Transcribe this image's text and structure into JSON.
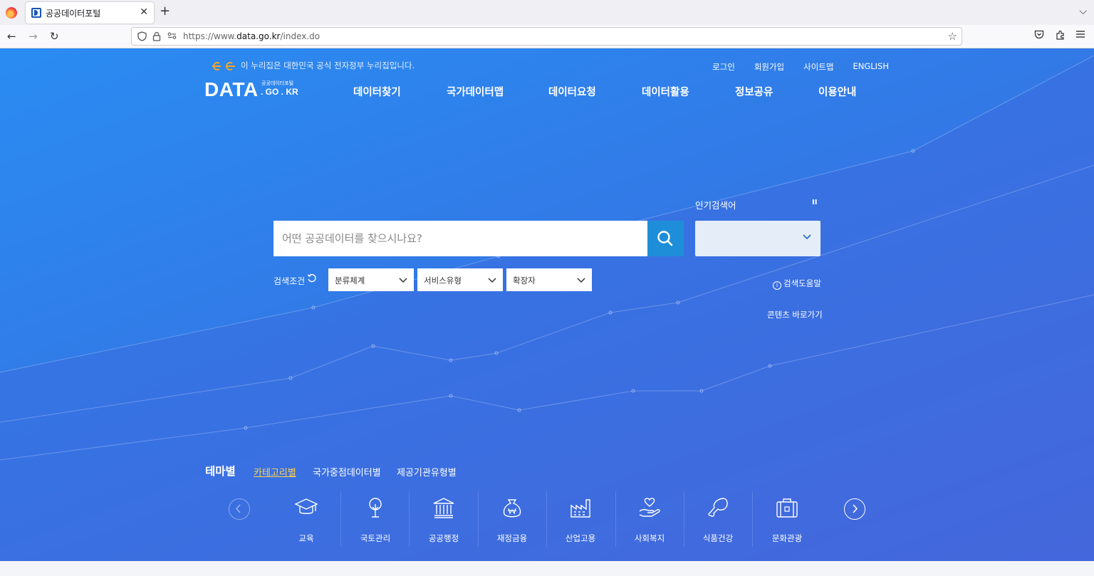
{
  "browser": {
    "tab_title": "공공데이터포털",
    "url_prefix": "https://www.",
    "url_domain": "data.go.kr",
    "url_path": "/index.do"
  },
  "header": {
    "gov_banner": "이 누리집은 대한민국 공식 전자정부 누리집입니다.",
    "util_links": [
      "로그인",
      "회원가입",
      "사이트맵",
      "ENGLISH"
    ],
    "logo_main": "DATA",
    "logo_sub": "공공데이터포털",
    "logo_domain": ". GO . KR",
    "nav": [
      "데이터찾기",
      "국가데이터맵",
      "데이터요청",
      "데이터활용",
      "정보공유",
      "이용안내"
    ]
  },
  "search": {
    "placeholder": "어떤 공공데이터를 찾으시나요?",
    "popular_label": "인기검색어",
    "popular_value": "",
    "pause_label": "II",
    "condition_label": "검색조건",
    "filters": [
      "분류체계",
      "서비스유형",
      "확장자"
    ],
    "help_link": "검색도움말",
    "help_icon_glyph": "i",
    "contents_link": "콘텐츠 바로가기"
  },
  "theme": {
    "title": "테마별",
    "tabs": [
      "카테고리별",
      "국가중점데이터별",
      "제공기관유형별"
    ],
    "active_tab": "카테고리별",
    "categories": [
      "교육",
      "국토관리",
      "공공행정",
      "재정금융",
      "산업고용",
      "사회복지",
      "식품건강",
      "문화관광"
    ]
  },
  "colors": {
    "accent": "#1f8ed9",
    "active_tab": "#ffd24d",
    "gov_mark": "#f5a623"
  }
}
